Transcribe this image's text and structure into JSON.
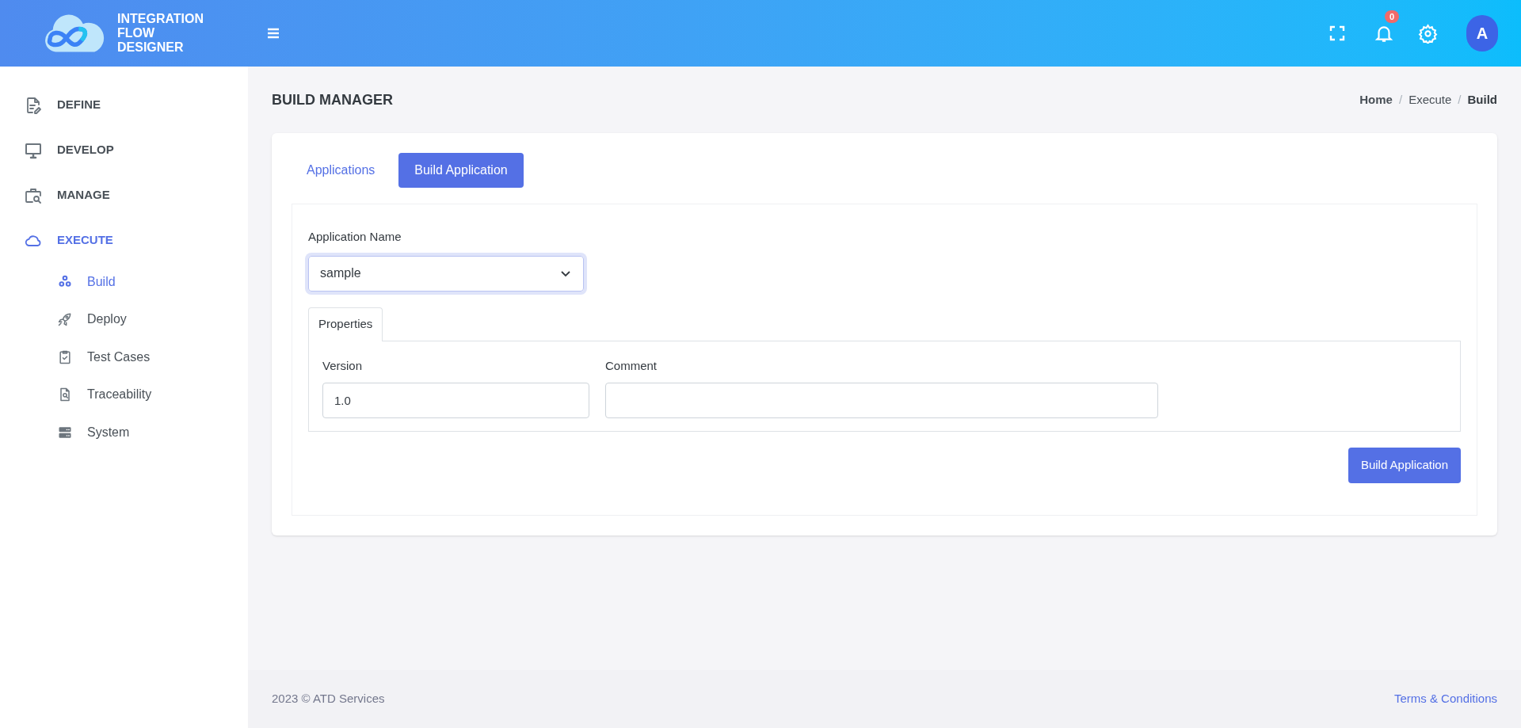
{
  "header": {
    "app_name": "INTEGRATION FLOW DESIGNER",
    "notification_count": "0",
    "avatar_initial": "A"
  },
  "sidebar": {
    "items": [
      {
        "label": "DEFINE",
        "selected": false
      },
      {
        "label": "DEVELOP",
        "selected": false
      },
      {
        "label": "MANAGE",
        "selected": false
      },
      {
        "label": "EXECUTE",
        "selected": true,
        "children": [
          {
            "label": "Build",
            "selected": true
          },
          {
            "label": "Deploy",
            "selected": false
          },
          {
            "label": "Test Cases",
            "selected": false
          },
          {
            "label": "Traceability",
            "selected": false
          },
          {
            "label": "System",
            "selected": false
          }
        ]
      }
    ]
  },
  "page": {
    "title": "BUILD MANAGER",
    "breadcrumb": [
      {
        "label": "Home",
        "current": false
      },
      {
        "separator": "/",
        "label": "Execute",
        "current": false
      },
      {
        "separator": "/",
        "label": "Build",
        "current": true
      }
    ]
  },
  "tabs": [
    {
      "label": "Applications",
      "selected": false
    },
    {
      "label": "Build Application",
      "selected": true
    }
  ],
  "form": {
    "application_name": {
      "label": "Application Name",
      "value": "sample"
    },
    "subtabs": [
      {
        "label": "Properties",
        "selected": true
      }
    ],
    "fields": [
      {
        "label": "Version",
        "value": "1.0"
      },
      {
        "label": "Comment"
      }
    ],
    "submit": "Build Application"
  },
  "footer": {
    "copyright": "2023 © ATD Services",
    "link": "Terms & Conditions"
  }
}
